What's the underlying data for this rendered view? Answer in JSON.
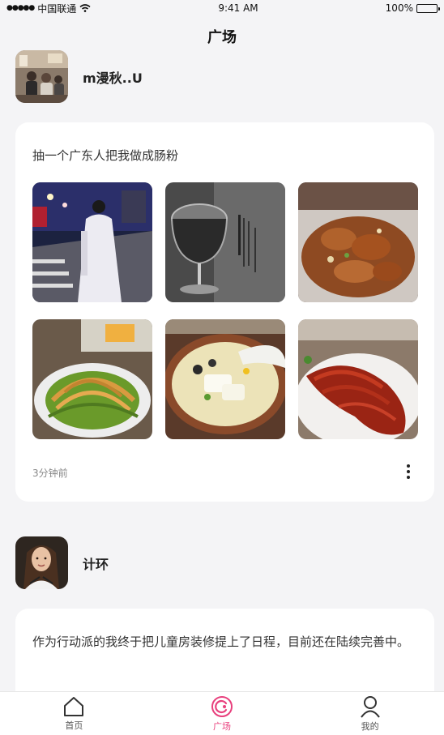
{
  "status": {
    "carrier": "中国联通",
    "time": "9:41 AM",
    "battery": "100%"
  },
  "header": {
    "title": "广场"
  },
  "posts": [
    {
      "user": "m漫秋..U",
      "text": "抽一个广东人把我做成肠粉",
      "photos": [
        {
          "subject": "night-street-person"
        },
        {
          "subject": "wine-glass"
        },
        {
          "subject": "fried-meat-dish"
        },
        {
          "subject": "shredded-salad"
        },
        {
          "subject": "tofu-soup-pot"
        },
        {
          "subject": "roast-duck"
        }
      ],
      "time": "3分钟前"
    },
    {
      "user": "计环",
      "text": "作为行动派的我终于把儿童房装修提上了日程，目前还在陆续完善中。"
    }
  ],
  "tabs": [
    {
      "label": "首页",
      "icon": "home-icon",
      "active": false
    },
    {
      "label": "广场",
      "icon": "plaza-icon",
      "active": true
    },
    {
      "label": "我的",
      "icon": "user-icon",
      "active": false
    }
  ],
  "colors": {
    "accent": "#e8407d",
    "background": "#f4f4f6"
  }
}
